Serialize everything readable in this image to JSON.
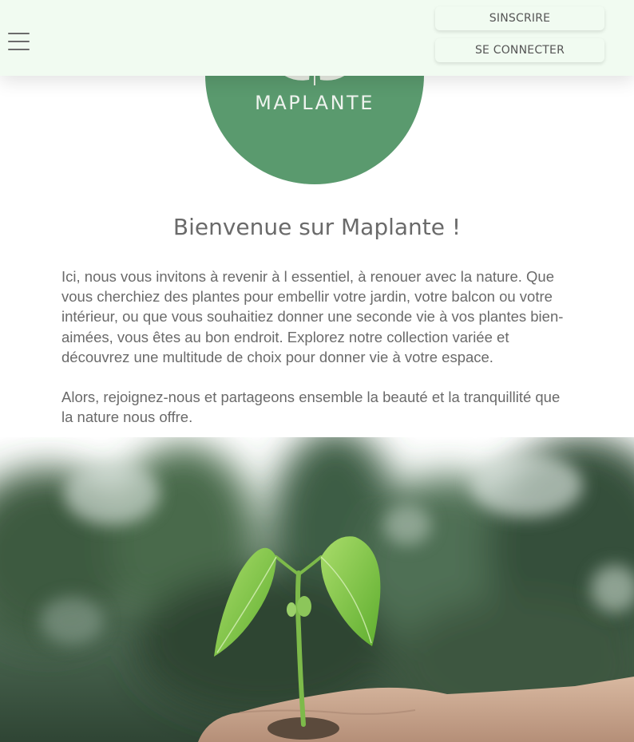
{
  "header": {
    "menu_icon": "hamburger-menu-icon",
    "signup_label": "SINSCRIRE",
    "login_label": "SE CONNECTER"
  },
  "logo": {
    "text": "MAPLANTE",
    "color": "#5a9a6e"
  },
  "welcome": {
    "title": "Bienvenue sur Maplante !",
    "paragraph1": "Ici, nous vous invitons à revenir à l essentiel, à renouer avec la nature. Que vous cherchiez des plantes pour embellir votre jardin, votre balcon ou votre intérieur, ou que vous souhaitiez donner une seconde vie à vos plantes bien-aimées, vous êtes au bon endroit. Explorez notre collection variée et découvrez une multitude de choix pour donner vie à votre espace.",
    "paragraph2": "Alors, rejoignez-nous et partageons ensemble la beauté et la tranquillité que la nature nous offre."
  },
  "hero": {
    "image": "seedling-in-hand-photo"
  },
  "colors": {
    "header_bg": "#f1fbf1",
    "text": "#6a6a6a",
    "accent": "#5a9a6e"
  }
}
